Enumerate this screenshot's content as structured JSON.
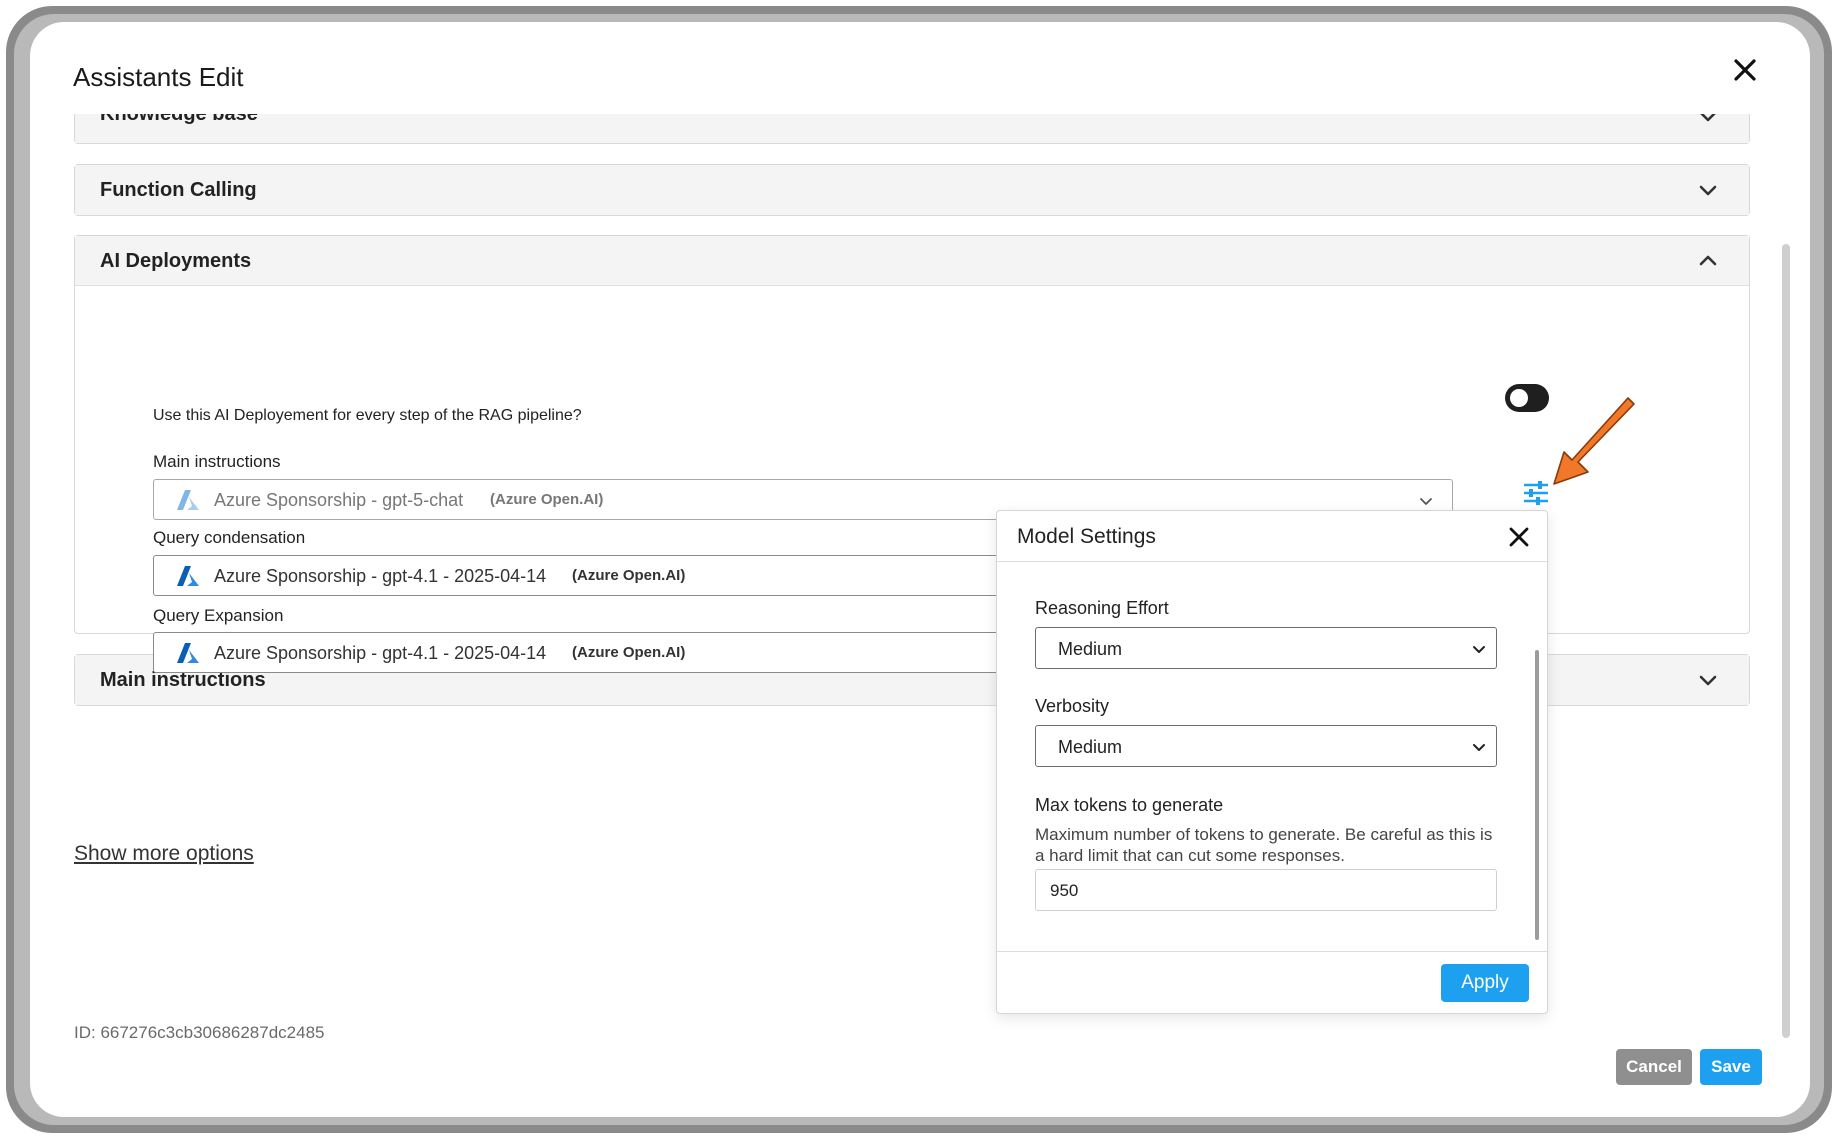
{
  "dialog": {
    "title": "Assistants Edit"
  },
  "panels": {
    "knowledge_base": {
      "title": "Knowledge base"
    },
    "function_calling": {
      "title": "Function Calling"
    },
    "ai_deployments": {
      "title": "AI Deployments",
      "toggle_question": "Use this AI Deployement for every step of the RAG pipeline?",
      "toggle_on": false,
      "fields": [
        {
          "label": "Main instructions",
          "model": "Azure Sponsorship - gpt-5-chat",
          "provider": "(Azure Open.AI)"
        },
        {
          "label": "Query condensation",
          "model": "Azure Sponsorship - gpt-4.1 - 2025-04-14",
          "provider": "(Azure Open.AI)"
        },
        {
          "label": "Query Expansion",
          "model": "Azure Sponsorship - gpt-4.1 - 2025-04-14",
          "provider": "(Azure Open.AI)"
        }
      ]
    },
    "main_instructions": {
      "title": "Main instructions"
    }
  },
  "show_more": "Show more options",
  "id_text": "ID:  667276c3cb30686287dc2485",
  "buttons": {
    "cancel": "Cancel",
    "save": "Save"
  },
  "model_settings": {
    "title": "Model Settings",
    "reasoning_effort": {
      "label": "Reasoning Effort",
      "value": "Medium"
    },
    "verbosity": {
      "label": "Verbosity",
      "value": "Medium"
    },
    "max_tokens": {
      "label": "Max tokens to generate",
      "help": "Maximum number of tokens to generate. Be careful as this is a hard limit that can cut some responses.",
      "value": "950"
    },
    "apply": "Apply"
  },
  "colors": {
    "accent": "#1ea0f0",
    "annotation_arrow": "#f07828",
    "azure_logo": "#0078d4"
  },
  "icons": [
    "close-icon",
    "chevron-down-icon",
    "chevron-up-icon",
    "azure-logo-icon",
    "settings-sliders-icon",
    "toggle-switch"
  ]
}
